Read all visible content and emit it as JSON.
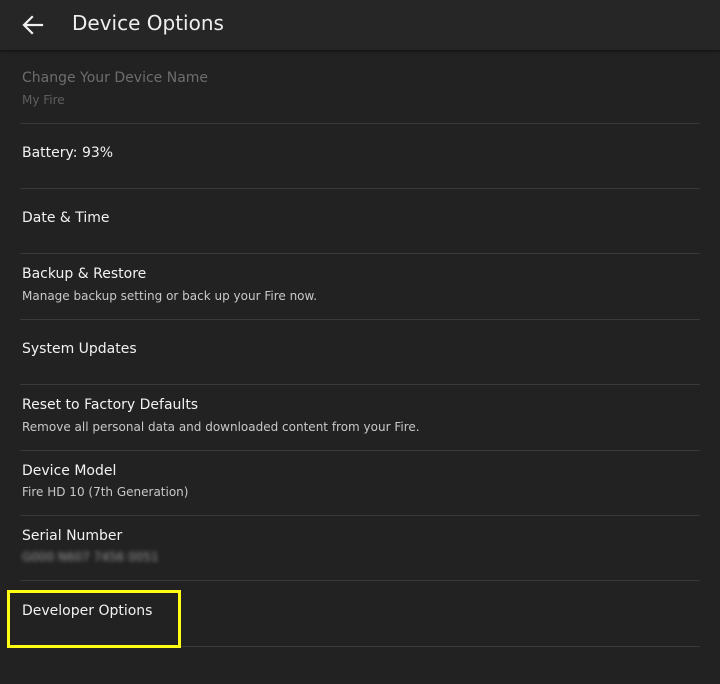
{
  "header": {
    "title": "Device Options"
  },
  "items": [
    {
      "label": "Change Your Device Name",
      "subtitle": "My Fire",
      "disabled": true
    },
    {
      "label": "Battery: 93%"
    },
    {
      "label": "Date & Time"
    },
    {
      "label": "Backup & Restore",
      "subtitle": "Manage backup setting or back up your Fire now."
    },
    {
      "label": "System Updates"
    },
    {
      "label": "Reset to Factory Defaults",
      "subtitle": "Remove all personal data and downloaded content from your Fire."
    },
    {
      "label": "Device Model",
      "subtitle": "Fire HD 10 (7th Generation)"
    },
    {
      "label": "Serial Number",
      "subtitle": "G000 N607 7456 0051"
    },
    {
      "label": "Developer Options"
    }
  ],
  "colors": {
    "background": "#222222",
    "header": "#262626",
    "highlight": "#ffff14"
  }
}
